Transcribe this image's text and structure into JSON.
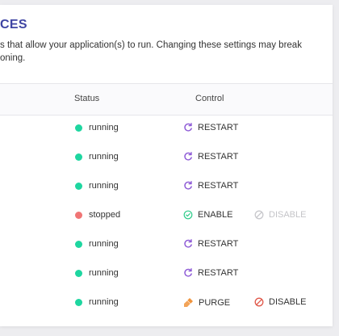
{
  "panel": {
    "title": "CES",
    "description_line1": "s that allow your application(s) to run. Changing these settings may break",
    "description_line2": "oning."
  },
  "table": {
    "headers": {
      "status": "Status",
      "control": "Control"
    },
    "rows": [
      {
        "status": "running",
        "status_color": "#1ed6a0",
        "actions": [
          {
            "label": "RESTART",
            "icon": "restart-icon",
            "color": "#8e5bd6",
            "enabled": true
          }
        ]
      },
      {
        "status": "running",
        "status_color": "#1ed6a0",
        "actions": [
          {
            "label": "RESTART",
            "icon": "restart-icon",
            "color": "#8e5bd6",
            "enabled": true
          }
        ]
      },
      {
        "status": "running",
        "status_color": "#1ed6a0",
        "actions": [
          {
            "label": "RESTART",
            "icon": "restart-icon",
            "color": "#8e5bd6",
            "enabled": true
          }
        ]
      },
      {
        "status": "stopped",
        "status_color": "#f07575",
        "actions": [
          {
            "label": "ENABLE",
            "icon": "check-circle-icon",
            "color": "#2ecc8a",
            "enabled": true
          },
          {
            "label": "DISABLE",
            "icon": "ban-icon",
            "color": "#c8c8cc",
            "enabled": false
          }
        ]
      },
      {
        "status": "running",
        "status_color": "#1ed6a0",
        "actions": [
          {
            "label": "RESTART",
            "icon": "restart-icon",
            "color": "#8e5bd6",
            "enabled": true
          }
        ]
      },
      {
        "status": "running",
        "status_color": "#1ed6a0",
        "actions": [
          {
            "label": "RESTART",
            "icon": "restart-icon",
            "color": "#8e5bd6",
            "enabled": true
          }
        ]
      },
      {
        "status": "running",
        "status_color": "#1ed6a0",
        "actions": [
          {
            "label": "PURGE",
            "icon": "broom-icon",
            "color": "#f0943c",
            "enabled": true
          },
          {
            "label": "DISABLE",
            "icon": "ban-icon",
            "color": "#e0584a",
            "enabled": true
          }
        ]
      }
    ]
  }
}
